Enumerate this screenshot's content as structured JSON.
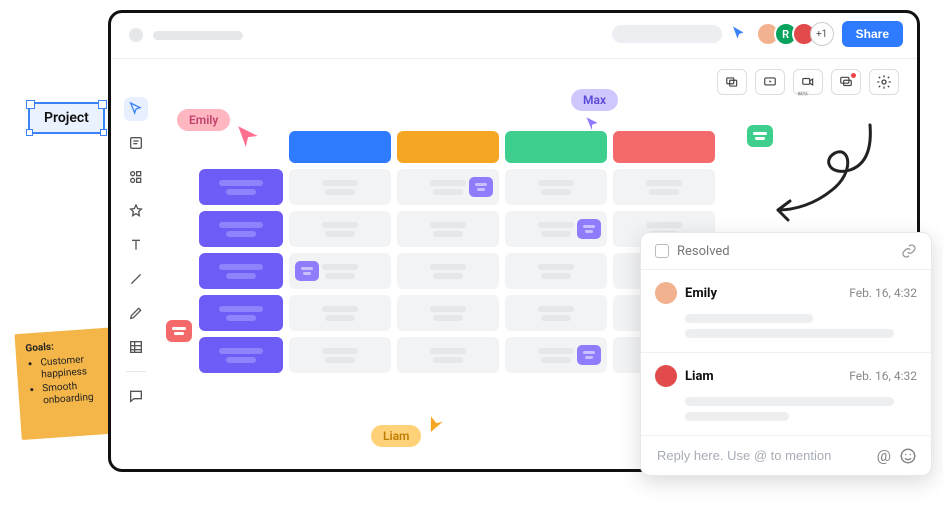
{
  "topbar": {
    "share_label": "Share",
    "overflow_count": "+1"
  },
  "subtools": {
    "beta_label": "BETA"
  },
  "project_tag": "Project",
  "cursors": {
    "emily": "Emily",
    "max": "Max",
    "liam": "Liam"
  },
  "sticky": {
    "heading": "Goals:",
    "items": [
      "Customer happiness",
      "Smooth onboarding"
    ]
  },
  "grid": {
    "header_colors": [
      "#2f7bff",
      "#f5a623",
      "#3ecf8e",
      "#f46a6a"
    ]
  },
  "comments": {
    "resolved_label": "Resolved",
    "items": [
      {
        "name": "Emily",
        "time": "Feb. 16, 4:32",
        "avatar_bg": "#f2b28f"
      },
      {
        "name": "Liam",
        "time": "Feb. 16, 4:32",
        "avatar_bg": "#e14b4b"
      }
    ],
    "reply_placeholder": "Reply here. Use @ to mention"
  }
}
